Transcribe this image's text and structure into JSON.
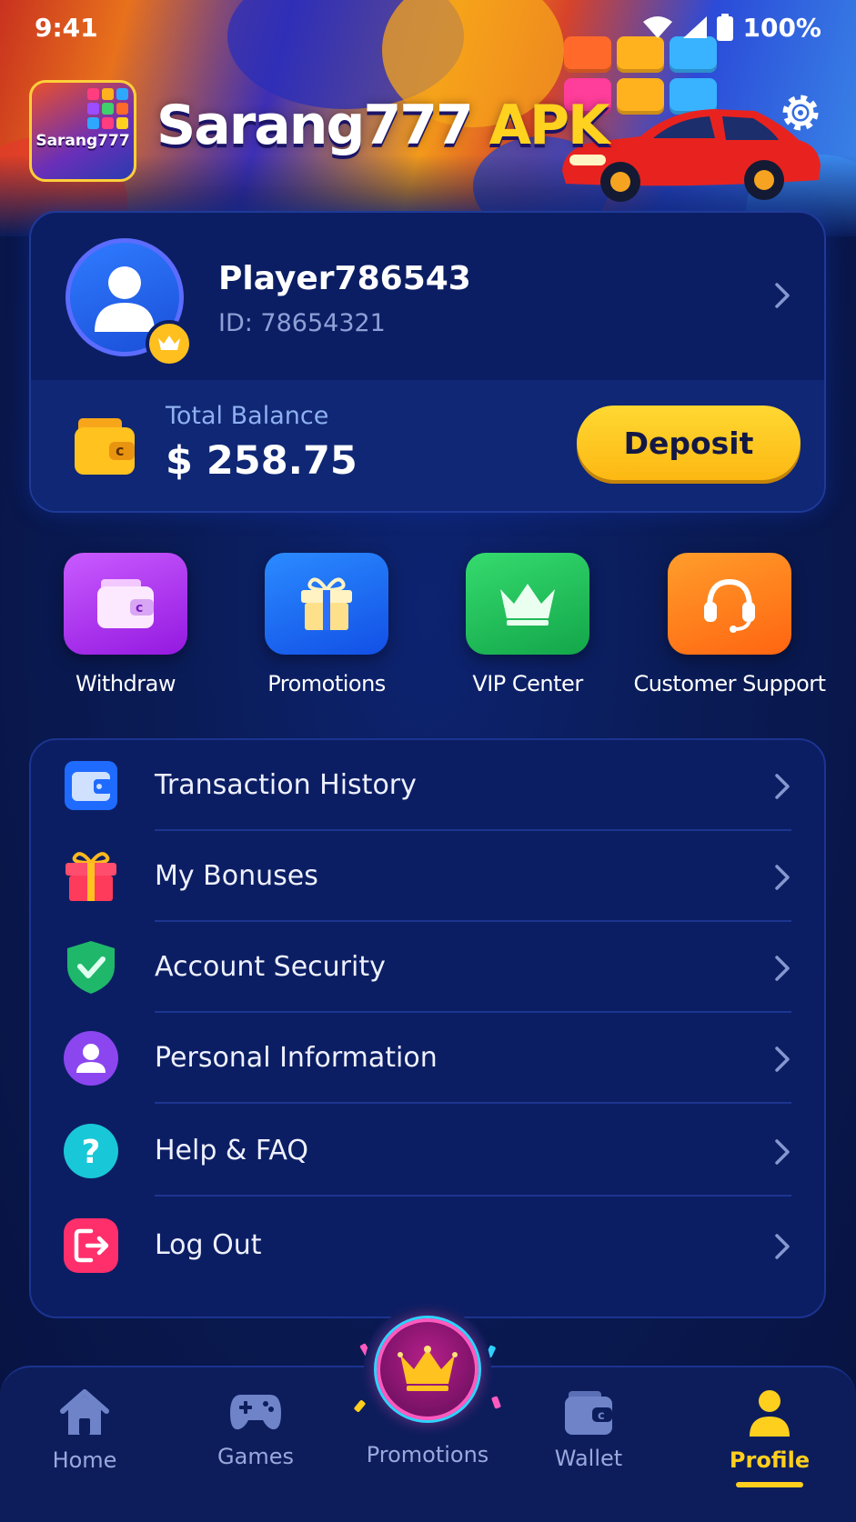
{
  "status_bar": {
    "time": "9:41",
    "battery": "100%"
  },
  "header": {
    "logo_text": "Sarang777",
    "title_main": "Sarang777",
    "title_accent": "APK"
  },
  "profile": {
    "username": "Player786543",
    "id_text": "ID: 78654321",
    "balance_label": "Total Balance",
    "balance_value": "$ 258.75",
    "deposit_label": "Deposit"
  },
  "quick_actions": [
    {
      "label": "Withdraw",
      "icon": "wallet-icon",
      "color": "#b63cf5"
    },
    {
      "label": "Promotions",
      "icon": "gift-icon",
      "color": "#1f6bff"
    },
    {
      "label": "VIP Center",
      "icon": "crown-icon",
      "color": "#22c55e"
    },
    {
      "label": "Customer Support",
      "icon": "headset-icon",
      "color": "#ff7a1a"
    }
  ],
  "menu": [
    {
      "label": "Transaction History",
      "icon": "wallet-icon"
    },
    {
      "label": "My Bonuses",
      "icon": "gift-icon"
    },
    {
      "label": "Account Security",
      "icon": "shield-check-icon"
    },
    {
      "label": "Personal Information",
      "icon": "user-icon"
    },
    {
      "label": "Help & FAQ",
      "icon": "question-icon"
    },
    {
      "label": "Log Out",
      "icon": "logout-icon"
    }
  ],
  "bottom_nav": [
    {
      "label": "Home",
      "icon": "home-icon"
    },
    {
      "label": "Games",
      "icon": "gamepad-icon"
    },
    {
      "label": "Promotions",
      "icon": "crown-icon"
    },
    {
      "label": "Wallet",
      "icon": "wallet-icon"
    },
    {
      "label": "Profile",
      "icon": "user-icon",
      "active": true
    }
  ],
  "colors": {
    "accent": "#ffcf1e",
    "background": "#0a1b55",
    "card": "#0c1e63"
  }
}
